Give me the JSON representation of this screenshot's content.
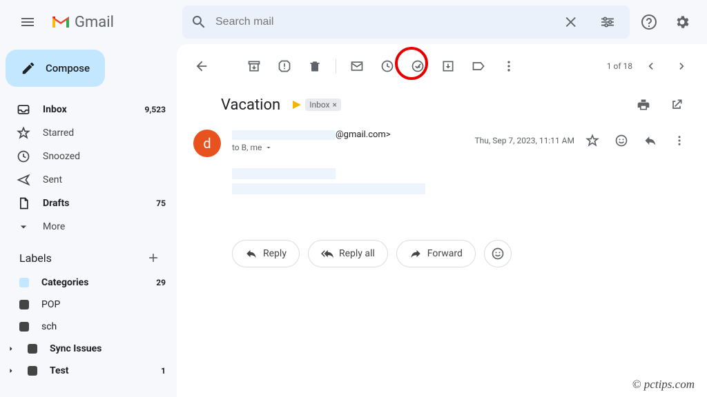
{
  "header": {
    "app_name": "Gmail",
    "search_placeholder": "Search mail"
  },
  "compose_label": "Compose",
  "nav": [
    {
      "icon": "inbox",
      "label": "Inbox",
      "count": "9,523",
      "bold": true
    },
    {
      "icon": "star",
      "label": "Starred",
      "count": "",
      "bold": false
    },
    {
      "icon": "clock",
      "label": "Snoozed",
      "count": "",
      "bold": false
    },
    {
      "icon": "send",
      "label": "Sent",
      "count": "",
      "bold": false
    },
    {
      "icon": "draft",
      "label": "Drafts",
      "count": "75",
      "bold": true
    },
    {
      "icon": "more",
      "label": "More",
      "count": "",
      "bold": false
    }
  ],
  "labels_header": "Labels",
  "labels": [
    {
      "label": "Categories",
      "count": "29",
      "bold": true,
      "color": "#c2e7ff"
    },
    {
      "label": "POP",
      "count": "",
      "bold": false,
      "color": "#444"
    },
    {
      "label": "sch",
      "count": "",
      "bold": false,
      "color": "#444"
    },
    {
      "label": "Sync Issues",
      "count": "",
      "bold": true,
      "color": "#444"
    },
    {
      "label": "Test",
      "count": "1",
      "bold": true,
      "color": "#444"
    }
  ],
  "toolbar": {
    "pagination": "1 of 18"
  },
  "email": {
    "subject": "Vacation",
    "label_chip": "Inbox",
    "sender_avatar_letter": "d",
    "sender_suffix": "@gmail.com>",
    "recipients": "to B, me",
    "date": "Thu, Sep 7, 2023, 11:11 AM"
  },
  "actions": {
    "reply": "Reply",
    "reply_all": "Reply all",
    "forward": "Forward"
  },
  "watermark": "© pctips.com"
}
